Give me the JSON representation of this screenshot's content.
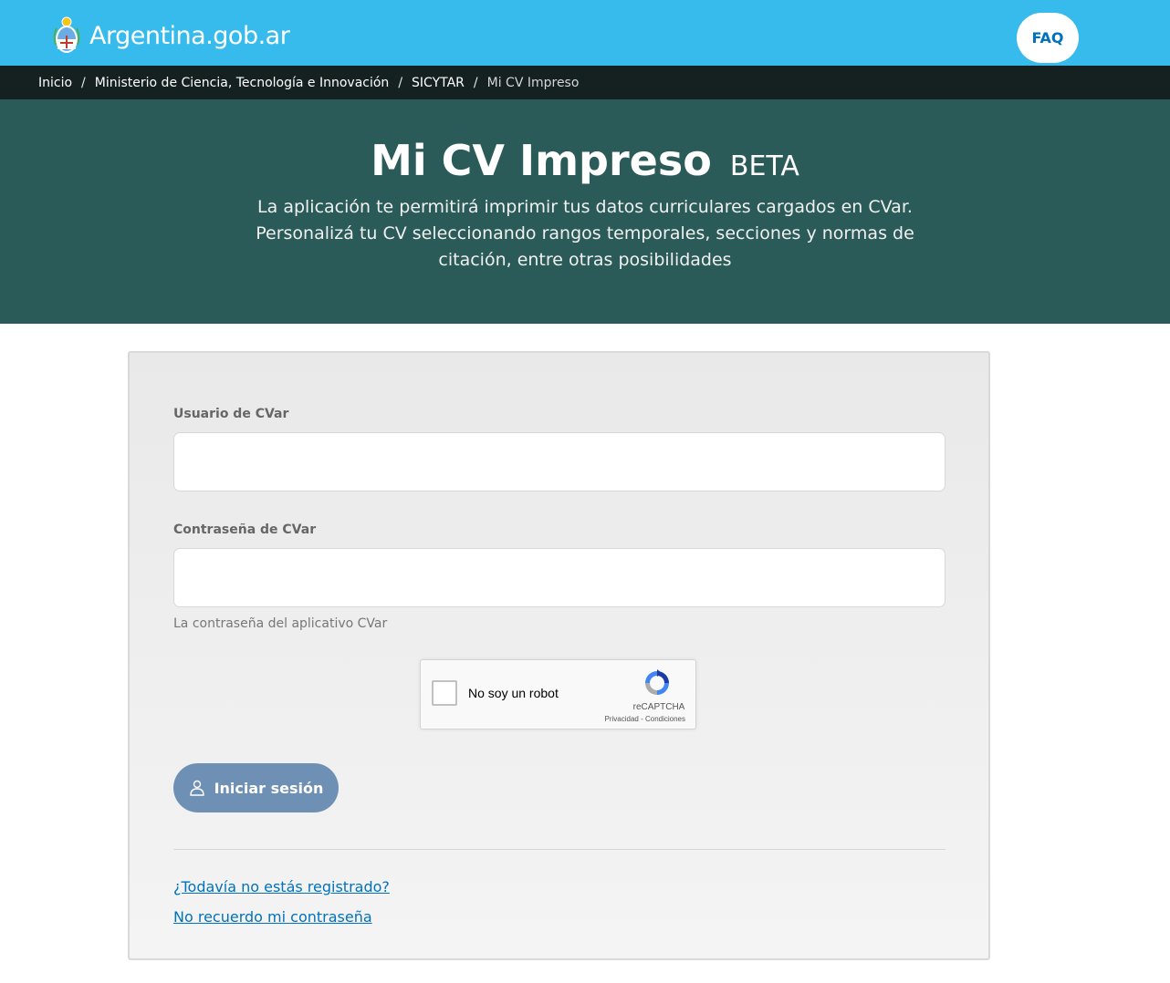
{
  "header": {
    "logo_text": "Argentina.gob.ar",
    "faq_label": "FAQ",
    "bg_color": "#37bbed"
  },
  "breadcrumb": {
    "items": [
      "Inicio",
      "Ministerio de Ciencia, Tecnología e Innovación",
      "SICYTAR"
    ],
    "current": "Mi CV Impreso",
    "separator": "/"
  },
  "hero": {
    "title": "Mi CV Impreso",
    "badge": "BETA",
    "description": "La aplicación te permitirá imprimir tus datos curriculares cargados en CVar. Personalizá tu CV seleccionando rangos temporales, secciones y normas de citación, entre otras posibilidades",
    "bg_color": "#2a5b58"
  },
  "form": {
    "username_label": "Usuario de CVar",
    "username_value": "",
    "password_label": "Contraseña de CVar",
    "password_value": "",
    "password_help": "La contraseña del aplicativo CVar",
    "captcha": {
      "label": "No soy un robot",
      "brand": "reCAPTCHA",
      "links": "Privacidad - Condiciones",
      "checked": false
    },
    "submit_label": "Iniciar sesión",
    "register_link": "¿Todavía no estás registrado?",
    "forgot_link": "No recuerdo mi contraseña"
  },
  "icons": {
    "logo": "argentina-coat-of-arms-icon",
    "login": "user-icon",
    "captcha": "recaptcha-icon"
  }
}
